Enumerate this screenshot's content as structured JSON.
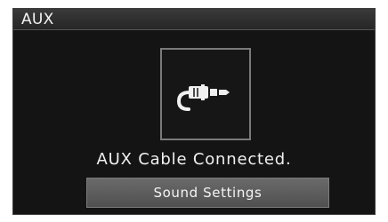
{
  "header": {
    "title": "AUX"
  },
  "status": {
    "icon": "aux-cable-icon",
    "message": "AUX Cable Connected."
  },
  "actions": {
    "sound_settings_label": "Sound Settings"
  },
  "colors": {
    "background": "#141414",
    "title_bar": "#2e2e2e",
    "button": "#5c5c5c",
    "text": "#f0f0f0"
  }
}
